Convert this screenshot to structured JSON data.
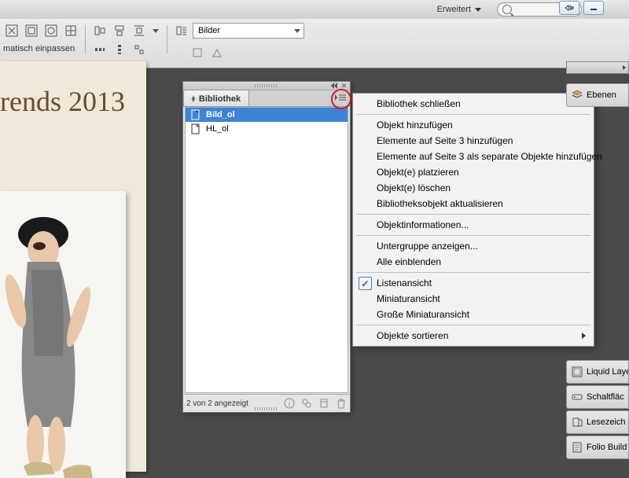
{
  "topbar": {
    "workspace": "Erweitert"
  },
  "toolbar": {
    "fit_label": "matisch einpassen",
    "combo_label": "Bilder"
  },
  "document": {
    "headline": "rends 2013"
  },
  "library_panel": {
    "tab_title": "Bibliothek",
    "items": [
      {
        "name": "Bild_ol",
        "selected": true
      },
      {
        "name": "HL_ol",
        "selected": false
      }
    ],
    "status": "2 von 2 angezeigt"
  },
  "context_menu": {
    "groups": [
      [
        {
          "label": "Bibliothek schließen"
        }
      ],
      [
        {
          "label": "Objekt hinzufügen"
        },
        {
          "label": "Elemente auf Seite 3 hinzufügen"
        },
        {
          "label": "Elemente auf Seite 3 als separate Objekte hinzufügen"
        },
        {
          "label": "Objekt(e) platzieren"
        },
        {
          "label": "Objekt(e) löschen"
        },
        {
          "label": "Bibliotheksobjekt aktualisieren"
        }
      ],
      [
        {
          "label": "Objektinformationen..."
        }
      ],
      [
        {
          "label": "Untergruppe anzeigen..."
        },
        {
          "label": "Alle einblenden"
        }
      ],
      [
        {
          "label": "Listenansicht",
          "checked": true
        },
        {
          "label": "Miniaturansicht"
        },
        {
          "label": "Große Miniaturansicht"
        }
      ],
      [
        {
          "label": "Objekte sortieren",
          "submenu": true
        }
      ]
    ]
  },
  "right_dock": {
    "items": [
      {
        "label": "Ebenen"
      },
      {
        "label": "Liquid Laye"
      },
      {
        "label": "Schaltfläc"
      },
      {
        "label": "Lesezeich"
      },
      {
        "label": "Folio Build"
      }
    ]
  }
}
